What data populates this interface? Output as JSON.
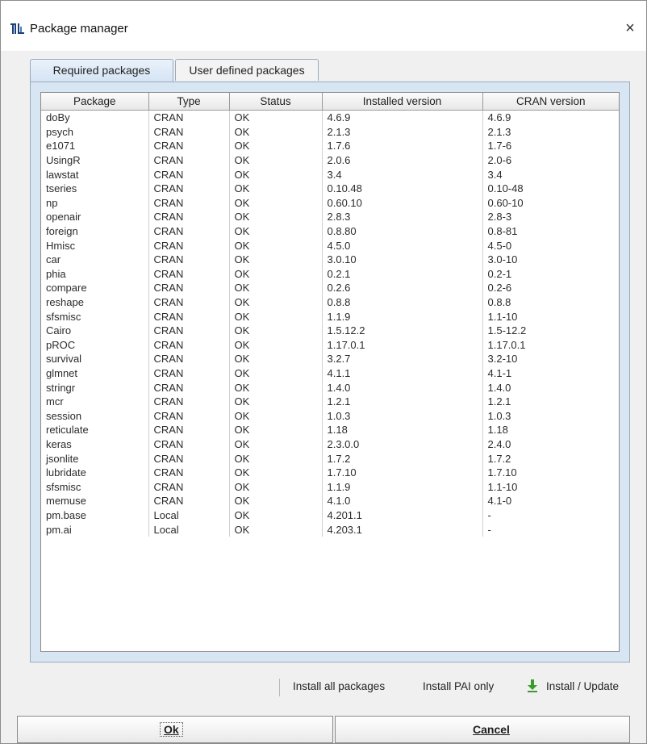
{
  "window": {
    "title": "Package manager",
    "close_symbol": "×",
    "icon": "pmod-app-icon"
  },
  "tabs": [
    {
      "label": "Required packages",
      "active": true
    },
    {
      "label": "User defined packages",
      "active": false
    }
  ],
  "table": {
    "columns": [
      "Package",
      "Type",
      "Status",
      "Installed version",
      "CRAN version"
    ],
    "rows": [
      [
        "doBy",
        "CRAN",
        "OK",
        "4.6.9",
        "4.6.9"
      ],
      [
        "psych",
        "CRAN",
        "OK",
        "2.1.3",
        "2.1.3"
      ],
      [
        "e1071",
        "CRAN",
        "OK",
        "1.7.6",
        "1.7-6"
      ],
      [
        "UsingR",
        "CRAN",
        "OK",
        "2.0.6",
        "2.0-6"
      ],
      [
        "lawstat",
        "CRAN",
        "OK",
        "3.4",
        "3.4"
      ],
      [
        "tseries",
        "CRAN",
        "OK",
        "0.10.48",
        "0.10-48"
      ],
      [
        "np",
        "CRAN",
        "OK",
        "0.60.10",
        "0.60-10"
      ],
      [
        "openair",
        "CRAN",
        "OK",
        "2.8.3",
        "2.8-3"
      ],
      [
        "foreign",
        "CRAN",
        "OK",
        "0.8.80",
        "0.8-81"
      ],
      [
        "Hmisc",
        "CRAN",
        "OK",
        "4.5.0",
        "4.5-0"
      ],
      [
        "car",
        "CRAN",
        "OK",
        "3.0.10",
        "3.0-10"
      ],
      [
        "phia",
        "CRAN",
        "OK",
        "0.2.1",
        "0.2-1"
      ],
      [
        "compare",
        "CRAN",
        "OK",
        "0.2.6",
        "0.2-6"
      ],
      [
        "reshape",
        "CRAN",
        "OK",
        "0.8.8",
        "0.8.8"
      ],
      [
        "sfsmisc",
        "CRAN",
        "OK",
        "1.1.9",
        "1.1-10"
      ],
      [
        "Cairo",
        "CRAN",
        "OK",
        "1.5.12.2",
        "1.5-12.2"
      ],
      [
        "pROC",
        "CRAN",
        "OK",
        "1.17.0.1",
        "1.17.0.1"
      ],
      [
        "survival",
        "CRAN",
        "OK",
        "3.2.7",
        "3.2-10"
      ],
      [
        "glmnet",
        "CRAN",
        "OK",
        "4.1.1",
        "4.1-1"
      ],
      [
        "stringr",
        "CRAN",
        "OK",
        "1.4.0",
        "1.4.0"
      ],
      [
        "mcr",
        "CRAN",
        "OK",
        "1.2.1",
        "1.2.1"
      ],
      [
        "session",
        "CRAN",
        "OK",
        "1.0.3",
        "1.0.3"
      ],
      [
        "reticulate",
        "CRAN",
        "OK",
        "1.18",
        "1.18"
      ],
      [
        "keras",
        "CRAN",
        "OK",
        "2.3.0.0",
        "2.4.0"
      ],
      [
        "jsonlite",
        "CRAN",
        "OK",
        "1.7.2",
        "1.7.2"
      ],
      [
        "lubridate",
        "CRAN",
        "OK",
        "1.7.10",
        "1.7.10"
      ],
      [
        "sfsmisc",
        "CRAN",
        "OK",
        "1.1.9",
        "1.1-10"
      ],
      [
        "memuse",
        "CRAN",
        "OK",
        "4.1.0",
        "4.1-0"
      ],
      [
        "pm.base",
        "Local",
        "OK",
        "4.201.1",
        "-"
      ],
      [
        "pm.ai",
        "Local",
        "OK",
        "4.203.1",
        "-"
      ]
    ]
  },
  "actions": {
    "install_all": "Install all packages",
    "install_pai": "Install PAI only",
    "install_update": "Install / Update",
    "install_update_icon": "download-arrow-icon"
  },
  "buttons": {
    "ok": "Ok",
    "cancel": "Cancel"
  },
  "colors": {
    "tab_active": "#d4e3f4",
    "panel_bg": "#d8e5f3",
    "download_icon": "#3c9a2e"
  }
}
